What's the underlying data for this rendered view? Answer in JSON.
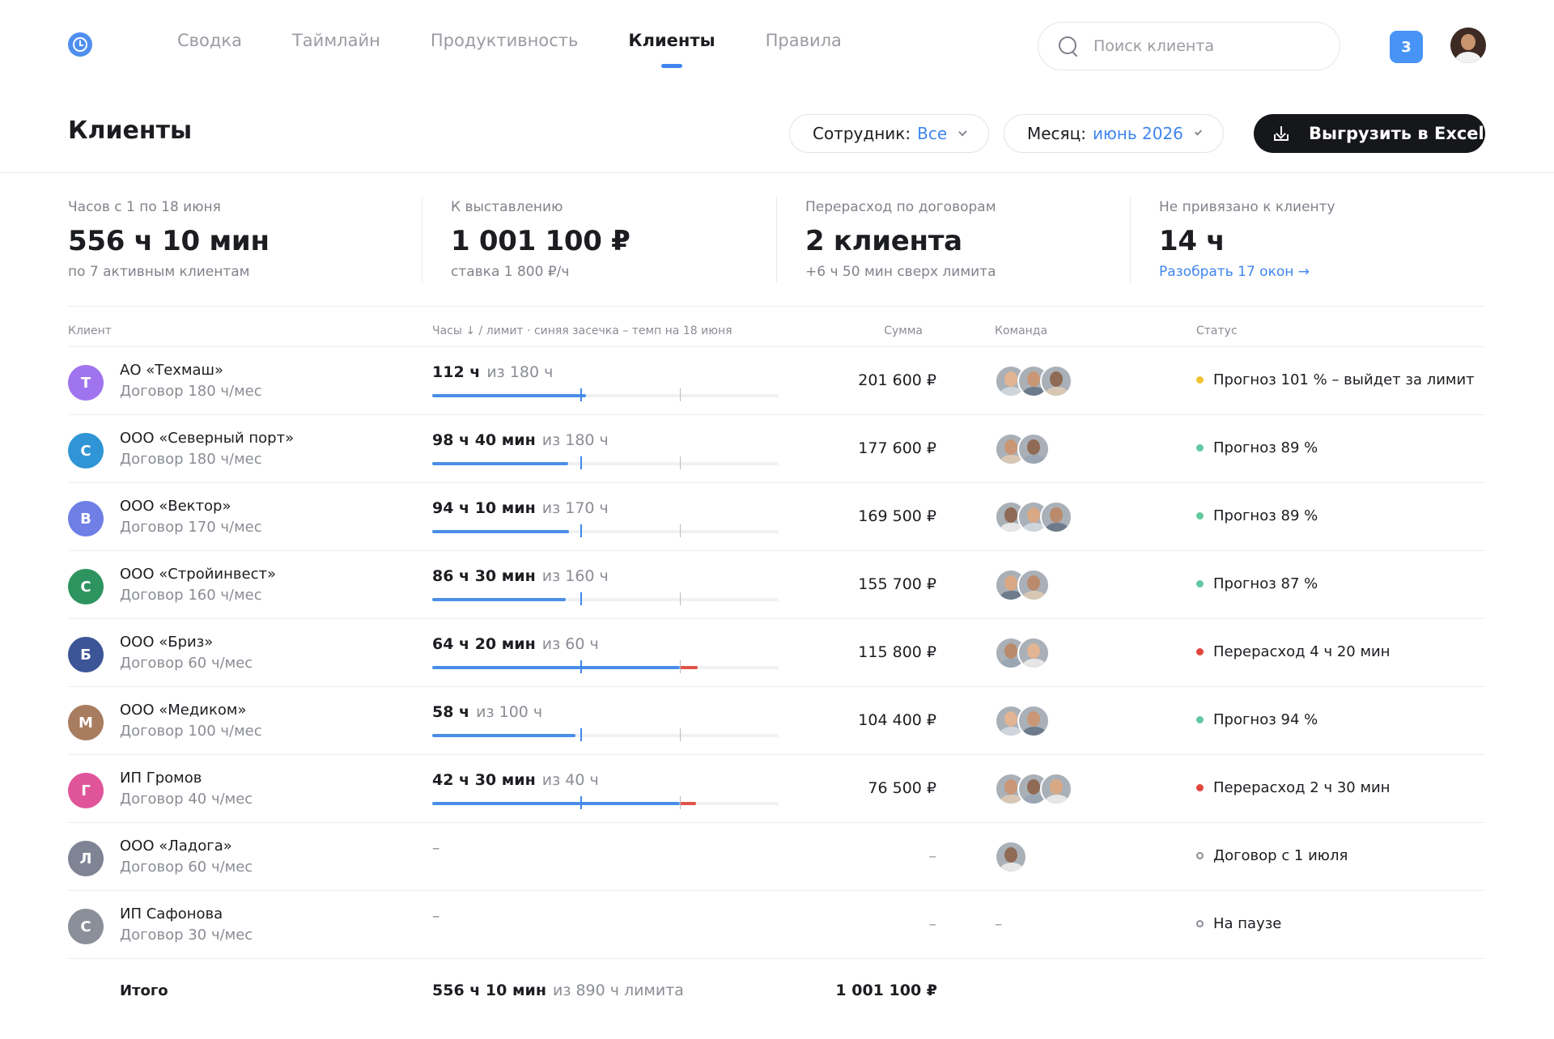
{
  "nav": {
    "tabs": [
      "Сводка",
      "Таймлайн",
      "Продуктивность",
      "Клиенты",
      "Правила"
    ],
    "active_index": 3,
    "search_placeholder": "Поиск клиента",
    "notifications_count": "3"
  },
  "header": {
    "title": "Клиенты",
    "employee_label": "Сотрудник:",
    "employee_value": "Все",
    "month_label": "Месяц:",
    "month_value": "июнь 2026",
    "export_label": "Выгрузить в Excel"
  },
  "kpis": [
    {
      "label": "Часов с 1 по 18 июня",
      "value": "556 ч 10 мин",
      "sub": "по 7 активным клиентам"
    },
    {
      "label": "К выставлению",
      "value": "1 001 100 ₽",
      "sub": "ставка 1 800 ₽/ч"
    },
    {
      "label": "Перерасход по договорам",
      "value": "2 клиента",
      "sub": "+6 ч 50 мин сверх лимита"
    },
    {
      "label": "Не привязано к клиенту",
      "value": "14 ч",
      "link": "Разобрать 17 окон →"
    }
  ],
  "table": {
    "headers": {
      "client": "Клиент",
      "hours": "Часы ↓ / лимит · синяя засечка – темп на 18 июня",
      "sum": "Сумма",
      "team": "Команда",
      "status": "Статус"
    },
    "rows": [
      {
        "initial": "Т",
        "color": "#a074ee",
        "name": "АО «Техмаш»",
        "contract": "Договор 180 ч/мес",
        "hours": "112 ч",
        "limit": "из 180 ч",
        "used": 112,
        "limit_h": 180,
        "sum": "201 600 ₽",
        "team": 3,
        "status": "Прогноз 101 % – выйдет за лимит",
        "status_color": "#f2c230",
        "status_kind": "dot"
      },
      {
        "initial": "С",
        "color": "#2f95d6",
        "name": "ООО «Северный порт»",
        "contract": "Договор 180 ч/мес",
        "hours": "98 ч 40 мин",
        "limit": "из 180 ч",
        "used": 98.67,
        "limit_h": 180,
        "sum": "177 600 ₽",
        "team": 2,
        "status": "Прогноз 89 %",
        "status_color": "#62c9a0",
        "status_kind": "dot"
      },
      {
        "initial": "В",
        "color": "#6f7fe6",
        "name": "ООО «Вектор»",
        "contract": "Договор 170 ч/мес",
        "hours": "94 ч 10 мин",
        "limit": "из 170 ч",
        "used": 94.17,
        "limit_h": 170,
        "sum": "169 500 ₽",
        "team": 3,
        "status": "Прогноз 89 %",
        "status_color": "#62c9a0",
        "status_kind": "dot"
      },
      {
        "initial": "С",
        "color": "#2d9460",
        "name": "ООО «Стройинвест»",
        "contract": "Договор 160 ч/мес",
        "hours": "86 ч 30 мин",
        "limit": "из 160 ч",
        "used": 86.5,
        "limit_h": 160,
        "sum": "155 700 ₽",
        "team": 2,
        "status": "Прогноз 87 %",
        "status_color": "#62c9a0",
        "status_kind": "dot"
      },
      {
        "initial": "Б",
        "color": "#3b5596",
        "name": "ООО «Бриз»",
        "contract": "Договор 60 ч/мес",
        "hours": "64 ч 20 мин",
        "limit": "из 60 ч",
        "used": 64.33,
        "limit_h": 60,
        "sum": "115 800 ₽",
        "team": 2,
        "status": "Перерасход 4 ч 20 мин",
        "status_color": "#e0453e",
        "status_kind": "dot"
      },
      {
        "initial": "М",
        "color": "#a87c5f",
        "name": "ООО «Медиком»",
        "contract": "Договор 100 ч/мес",
        "hours": "58 ч",
        "limit": "из 100 ч",
        "used": 58,
        "limit_h": 100,
        "sum": "104 400 ₽",
        "team": 2,
        "status": "Прогноз 94 %",
        "status_color": "#62c9a0",
        "status_kind": "dot"
      },
      {
        "initial": "Г",
        "color": "#e0559a",
        "name": "ИП Громов",
        "contract": "Договор 40 ч/мес",
        "hours": "42 ч 30 мин",
        "limit": "из 40 ч",
        "used": 42.5,
        "limit_h": 40,
        "sum": "76 500 ₽",
        "team": 3,
        "status": "Перерасход 2 ч 30 мин",
        "status_color": "#e0453e",
        "status_kind": "dot"
      },
      {
        "initial": "Л",
        "color": "#7f8495",
        "name": "ООО «Ладога»",
        "contract": "Договор 60 ч/мес",
        "hours": "–",
        "limit": "",
        "used": null,
        "limit_h": 60,
        "sum": "–",
        "team": 1,
        "status": "Договор с 1 июля",
        "status_color": "#8a8d94",
        "status_kind": "ring"
      },
      {
        "initial": "С",
        "color": "#8b8f99",
        "name": "ИП Сафонова",
        "contract": "Договор 30 ч/мес",
        "hours": "–",
        "limit": "",
        "used": null,
        "limit_h": 30,
        "sum": "–",
        "team": 0,
        "team_dash": "–",
        "status": "На паузе",
        "status_color": "#8a8d94",
        "status_kind": "ring"
      }
    ],
    "total": {
      "label": "Итого",
      "hours": "556 ч 10 мин",
      "limit": "из 890 ч лимита",
      "sum": "1 001 100 ₽"
    }
  }
}
